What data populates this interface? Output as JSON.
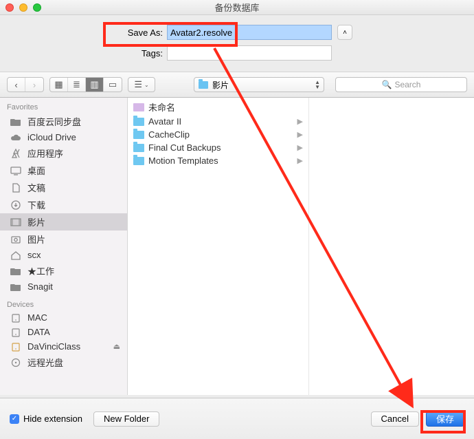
{
  "window": {
    "title": "备份数据库"
  },
  "form": {
    "saveas_label": "Save As:",
    "saveas_value": "Avatar2.resolve",
    "tags_label": "Tags:",
    "tags_value": ""
  },
  "toolbar": {
    "path_label": "影片",
    "search_placeholder": "Search"
  },
  "sidebar": {
    "favorites_header": "Favorites",
    "devices_header": "Devices",
    "favorites": [
      {
        "label": "百度云同步盘",
        "icon": "folder"
      },
      {
        "label": "iCloud Drive",
        "icon": "cloud"
      },
      {
        "label": "应用程序",
        "icon": "apps"
      },
      {
        "label": "桌面",
        "icon": "desktop"
      },
      {
        "label": "文稿",
        "icon": "docs"
      },
      {
        "label": "下载",
        "icon": "downloads"
      },
      {
        "label": "影片",
        "icon": "movies",
        "active": true
      },
      {
        "label": "图片",
        "icon": "pictures"
      },
      {
        "label": "scx",
        "icon": "home"
      },
      {
        "label": "★工作",
        "icon": "folder"
      },
      {
        "label": "Snagit",
        "icon": "folder"
      }
    ],
    "devices": [
      {
        "label": "MAC",
        "icon": "disk"
      },
      {
        "label": "DATA",
        "icon": "disk"
      },
      {
        "label": "DaVinciClass",
        "icon": "disk-ext",
        "eject": true
      },
      {
        "label": "远程光盘",
        "icon": "remote-disc"
      }
    ]
  },
  "files": [
    {
      "label": "未命名",
      "icon": "clip",
      "expandable": false
    },
    {
      "label": "Avatar II",
      "icon": "folder",
      "expandable": true
    },
    {
      "label": "CacheClip",
      "icon": "folder",
      "expandable": true
    },
    {
      "label": "Final Cut Backups",
      "icon": "folder",
      "expandable": true
    },
    {
      "label": "Motion Templates",
      "icon": "folder",
      "expandable": true
    }
  ],
  "footer": {
    "hide_ext_label": "Hide extension",
    "hide_ext_checked": true,
    "new_folder_label": "New Folder",
    "cancel_label": "Cancel",
    "save_label": "保存"
  },
  "colors": {
    "accent": "#1e72e8",
    "annotation": "#ff2a1a"
  }
}
